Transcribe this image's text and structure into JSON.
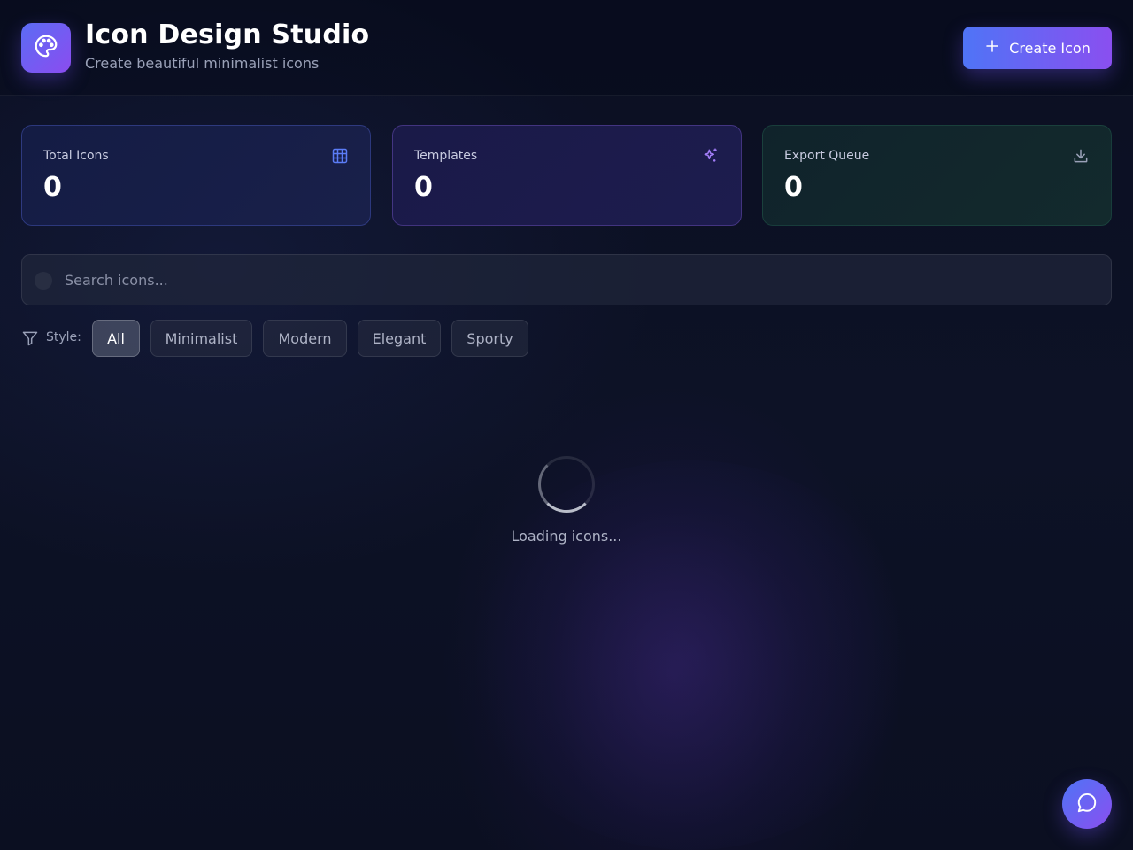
{
  "header": {
    "title": "Icon Design Studio",
    "subtitle": "Create beautiful minimalist icons",
    "logo_icon": "palette-icon",
    "create_button": {
      "label": "Create Icon",
      "icon": "plus-icon"
    }
  },
  "stats": [
    {
      "label": "Total Icons",
      "value": "0",
      "icon": "grid-icon",
      "icon_color": "#5b7cf6"
    },
    {
      "label": "Templates",
      "value": "0",
      "icon": "sparkles-icon",
      "icon_color": "#a07cf5"
    },
    {
      "label": "Export Queue",
      "value": "0",
      "icon": "download-icon",
      "icon_color": "#9aa1b8"
    }
  ],
  "search": {
    "placeholder": "Search icons...",
    "value": "",
    "icon": "search-icon"
  },
  "filters": {
    "label": "Style:",
    "icon": "filter-icon",
    "options": [
      "All",
      "Minimalist",
      "Modern",
      "Elegant",
      "Sporty"
    ],
    "selected": "All"
  },
  "loading": {
    "text": "Loading icons..."
  },
  "chat_button": {
    "icon": "message-circle-icon"
  },
  "colors": {
    "accent_start": "#4f74f6",
    "accent_end": "#8a4ff0",
    "background": "#0b0f22"
  }
}
